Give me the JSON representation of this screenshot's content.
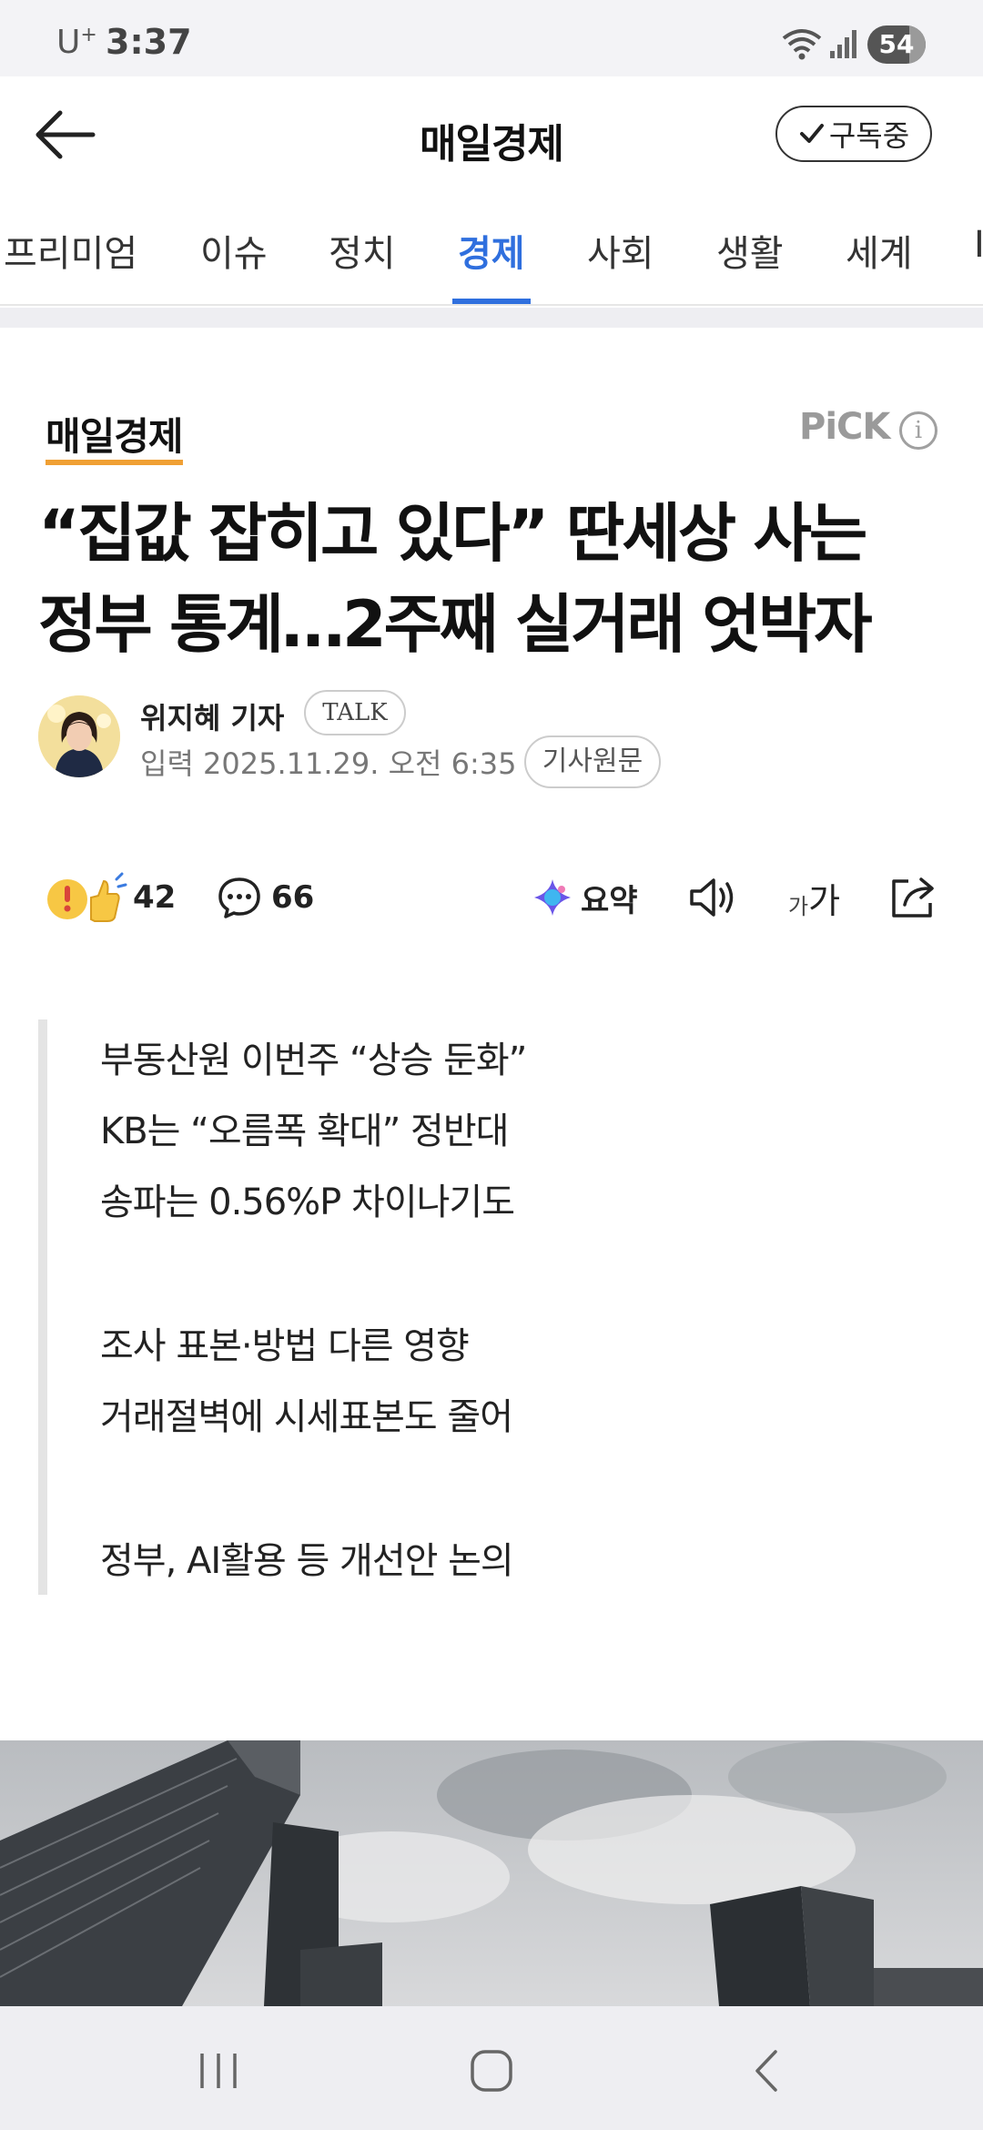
{
  "status_bar": {
    "carrier": "U",
    "carrier_sup": "+",
    "time": "3:37",
    "battery": "54",
    "icons": [
      "wifi-icon",
      "signal-icon",
      "battery-icon"
    ]
  },
  "header": {
    "title": "매일경제",
    "subscribe_label": "구독중"
  },
  "categories": [
    {
      "label": "프리미엄",
      "active": false
    },
    {
      "label": "이슈",
      "active": false
    },
    {
      "label": "정치",
      "active": false
    },
    {
      "label": "경제",
      "active": true
    },
    {
      "label": "사회",
      "active": false
    },
    {
      "label": "생활",
      "active": false
    },
    {
      "label": "세계",
      "active": false
    },
    {
      "label": "I",
      "active": false
    }
  ],
  "article": {
    "press": "매일경제",
    "pick_label": "PiCK",
    "pick_info": "i",
    "headline_line1": "“집값 잡히고 있다” 딴세상 사는",
    "headline_line2": "정부 통계…2주째 실거래 엇박자",
    "reporter": "위지혜 기자",
    "talk_label": "TALK",
    "date": "입력 2025.11.29. 오전 6:35",
    "original_label": "기사원문"
  },
  "actions": {
    "reaction_count": "42",
    "comment_count": "66",
    "summary_label": "요약",
    "font_size_small": "가",
    "font_size_large": "가"
  },
  "summary": [
    "부동산원 이번주 “상승 둔화”",
    "KB는 “오름폭 확대” 정반대",
    "송파는 0.56%P 차이나기도",
    "조사 표본·방법 다른 영향",
    "거래절벽에 시세표본도 줄어",
    "정부, AI활용 등 개선안 논의"
  ],
  "colors": {
    "accent": "#2f6fde",
    "press_underline": "#f0a034"
  }
}
